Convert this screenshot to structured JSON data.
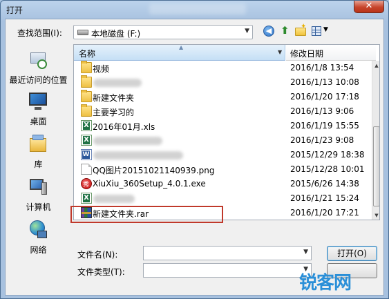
{
  "window": {
    "title": "打开",
    "close_glyph": "✕"
  },
  "lookin": {
    "label": "查找范围(I):",
    "value": "本地磁盘 (F:)"
  },
  "places": [
    {
      "label": "最近访问的位置",
      "icon": "recent-places-icon"
    },
    {
      "label": "桌面",
      "icon": "desktop-icon"
    },
    {
      "label": "库",
      "icon": "libraries-icon"
    },
    {
      "label": "计算机",
      "icon": "computer-icon"
    },
    {
      "label": "网络",
      "icon": "network-icon"
    }
  ],
  "columns": {
    "name": "名称",
    "date": "修改日期"
  },
  "files": [
    {
      "name": "视频",
      "date": "2016/1/8 13:54",
      "type": "folder"
    },
    {
      "name": "",
      "date": "2016/1/13 10:08",
      "type": "folder",
      "blurred": true
    },
    {
      "name": "新建文件夹",
      "date": "2016/1/20 17:18",
      "type": "folder"
    },
    {
      "name": "主要学习的",
      "date": "2016/1/13 9:06",
      "type": "folder"
    },
    {
      "name": "2016年01月.xls",
      "date": "2016/1/19 15:55",
      "type": "xls"
    },
    {
      "name": "",
      "date": "2016/1/23 9:08",
      "type": "xls",
      "blurred": true
    },
    {
      "name": "",
      "date": "2015/12/29 18:38",
      "type": "doc",
      "blurred": true
    },
    {
      "name": "QQ图片20151021140939.png",
      "date": "2015/12/28 10:01",
      "type": "png"
    },
    {
      "name": "XiuXiu_360Setup_4.0.1.exe",
      "date": "2015/6/26 14:38",
      "type": "exe"
    },
    {
      "name": "",
      "date": "2016/1/21 15:24",
      "type": "xls",
      "blurred": true
    },
    {
      "name": "新建文件夹.rar",
      "date": "2016/1/20 17:21",
      "type": "rar",
      "highlighted": true
    }
  ],
  "filename": {
    "label": "文件名(N):",
    "value": ""
  },
  "filetype": {
    "label": "文件类型(T):",
    "value": ""
  },
  "buttons": {
    "open": "打开(O)",
    "cancel": ""
  },
  "watermark": {
    "text": "锐客网",
    "sub": ""
  },
  "colors": {
    "highlight": "#c0392b",
    "header": "#c5dff5"
  }
}
